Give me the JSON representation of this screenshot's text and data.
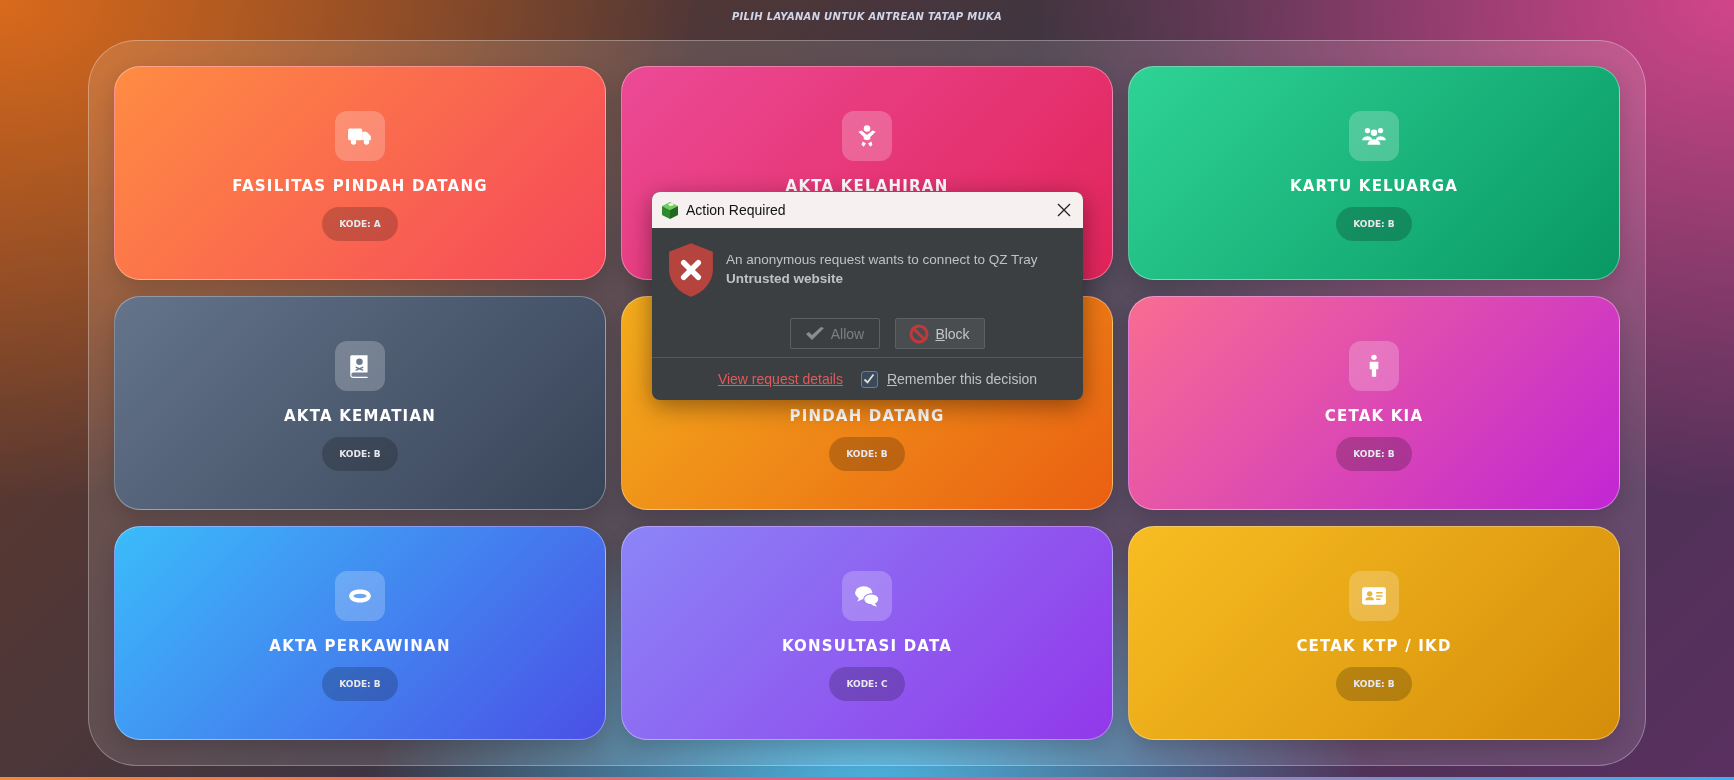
{
  "header": {
    "subtitle": "PILIH LAYANAN UNTUK ANTREAN TATAP MUKA"
  },
  "services": [
    {
      "title": "FASILITAS PINDAH DATANG",
      "code": "KODE: A",
      "kind": "truck"
    },
    {
      "title": "AKTA KELAHIRAN",
      "kind": "baby"
    },
    {
      "title": "KARTU KELUARGA",
      "code": "KODE: B",
      "kind": "family"
    },
    {
      "title": "AKTA KEMATIAN",
      "code": "KODE: B",
      "kind": "book"
    },
    {
      "title": "PINDAH DATANG",
      "code": "KODE: B"
    },
    {
      "title": "CETAK KIA",
      "code": "KODE: B",
      "kind": "child"
    },
    {
      "title": "AKTA PERKAWINAN",
      "code": "KODE: B",
      "kind": "ring"
    },
    {
      "title": "KONSULTASI DATA",
      "code": "KODE: C",
      "kind": "chat"
    },
    {
      "title": "CETAK KTP / IKD",
      "code": "KODE: B",
      "kind": "card"
    }
  ],
  "dialog": {
    "title": "Action Required",
    "message": "An anonymous request wants to connect to QZ Tray",
    "status": "Untrusted website",
    "buttons": [
      {
        "label": "Allow",
        "kind": "allow",
        "disabled": true
      },
      {
        "label": "Block",
        "kind": "block",
        "disabled": false
      }
    ],
    "link": "View request details",
    "remember": {
      "label": "Remember this decision",
      "checked": true
    }
  }
}
